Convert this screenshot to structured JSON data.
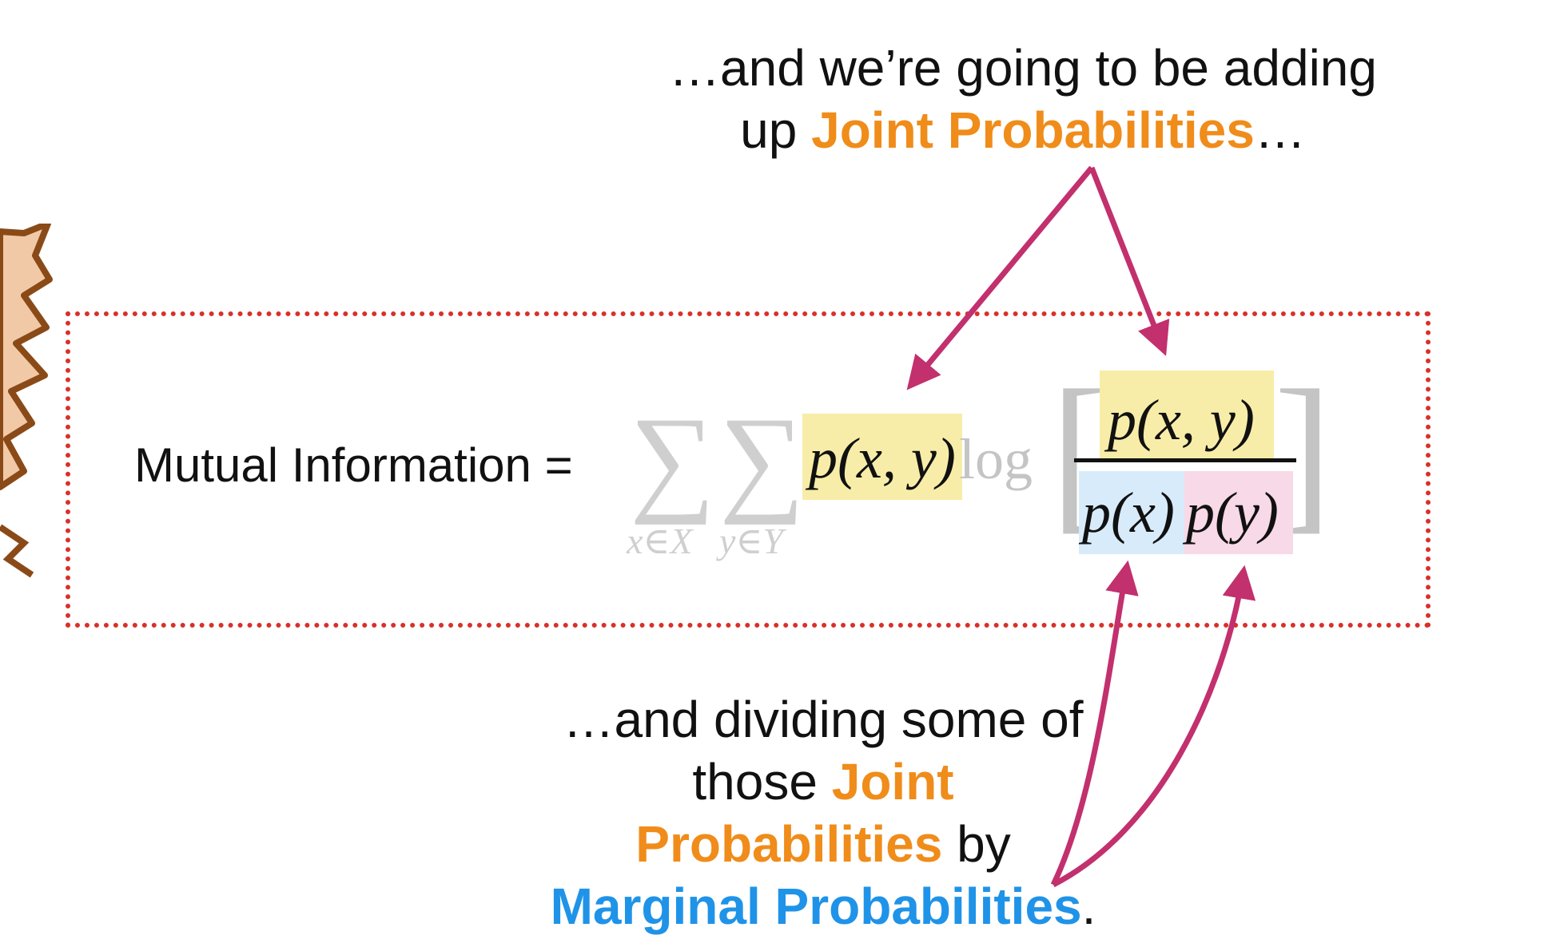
{
  "top_callout": {
    "line1": "…and we’re going to be adding",
    "line2_prefix": "up ",
    "line2_highlight": "Joint Probabilities",
    "line2_suffix": "…"
  },
  "formula": {
    "label": "Mutual Information =",
    "sigma_1": "∑",
    "sigma_2": "∑",
    "sub_1": "x∈X",
    "sub_2": "y∈Y",
    "joint_term": "p(x, y)",
    "log": "log",
    "bracket_left": "[",
    "bracket_right": "]",
    "numerator": "p(x, y)",
    "denominator_x": "p(x)",
    "denominator_y": "p(y)"
  },
  "bottom_callout": {
    "line1": "…and dividing some of",
    "line2_prefix": "those ",
    "line2_highlight": "Joint",
    "line3_highlight": "Probabilities",
    "line3_suffix": " by",
    "line4_highlight": "Marginal Probabilities",
    "line4_suffix": "."
  },
  "colors": {
    "orange": "#f08c1a",
    "blue": "#1f93e8",
    "arrow": "#c2306e",
    "box_border": "#d9302a",
    "yellow_highlight": "#f8eda8",
    "blue_highlight": "#d8ebfb",
    "pink_highlight": "#f8d9e7"
  }
}
